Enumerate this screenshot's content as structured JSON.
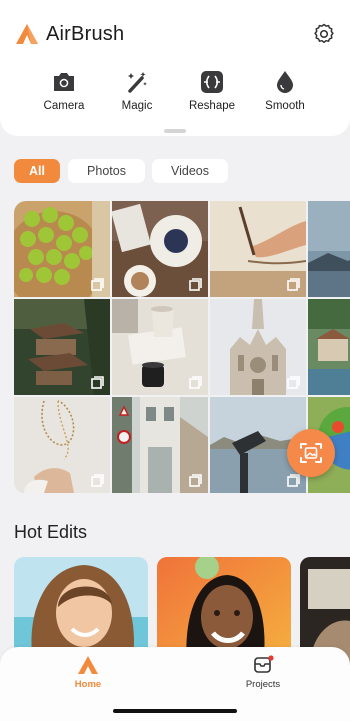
{
  "app": {
    "title": "AirBrush"
  },
  "tools": [
    {
      "label": "Camera",
      "icon": "camera-icon"
    },
    {
      "label": "Magic",
      "icon": "magic-wand-icon"
    },
    {
      "label": "Reshape",
      "icon": "reshape-icon"
    },
    {
      "label": "Smooth",
      "icon": "droplet-icon"
    }
  ],
  "filters": [
    {
      "label": "All",
      "selected": true
    },
    {
      "label": "Photos",
      "selected": false
    },
    {
      "label": "Videos",
      "selected": false
    }
  ],
  "gallery": {
    "items": [
      "limes-photo",
      "coffee-blueberries-photo",
      "painting-hand-photo",
      "mountain-lake-photo",
      "treehouse-photo",
      "coffee-cups-photo",
      "cathedral-photo",
      "harbor-photo",
      "necklace-photo",
      "street-building-photo",
      "binoculars-photo",
      "parrot-photo"
    ]
  },
  "sections": {
    "hot_edits": "Hot Edits"
  },
  "tabbar": {
    "home": "Home",
    "projects": "Projects"
  },
  "colors": {
    "accent": "#f28a3e",
    "notification": "#e53935"
  }
}
